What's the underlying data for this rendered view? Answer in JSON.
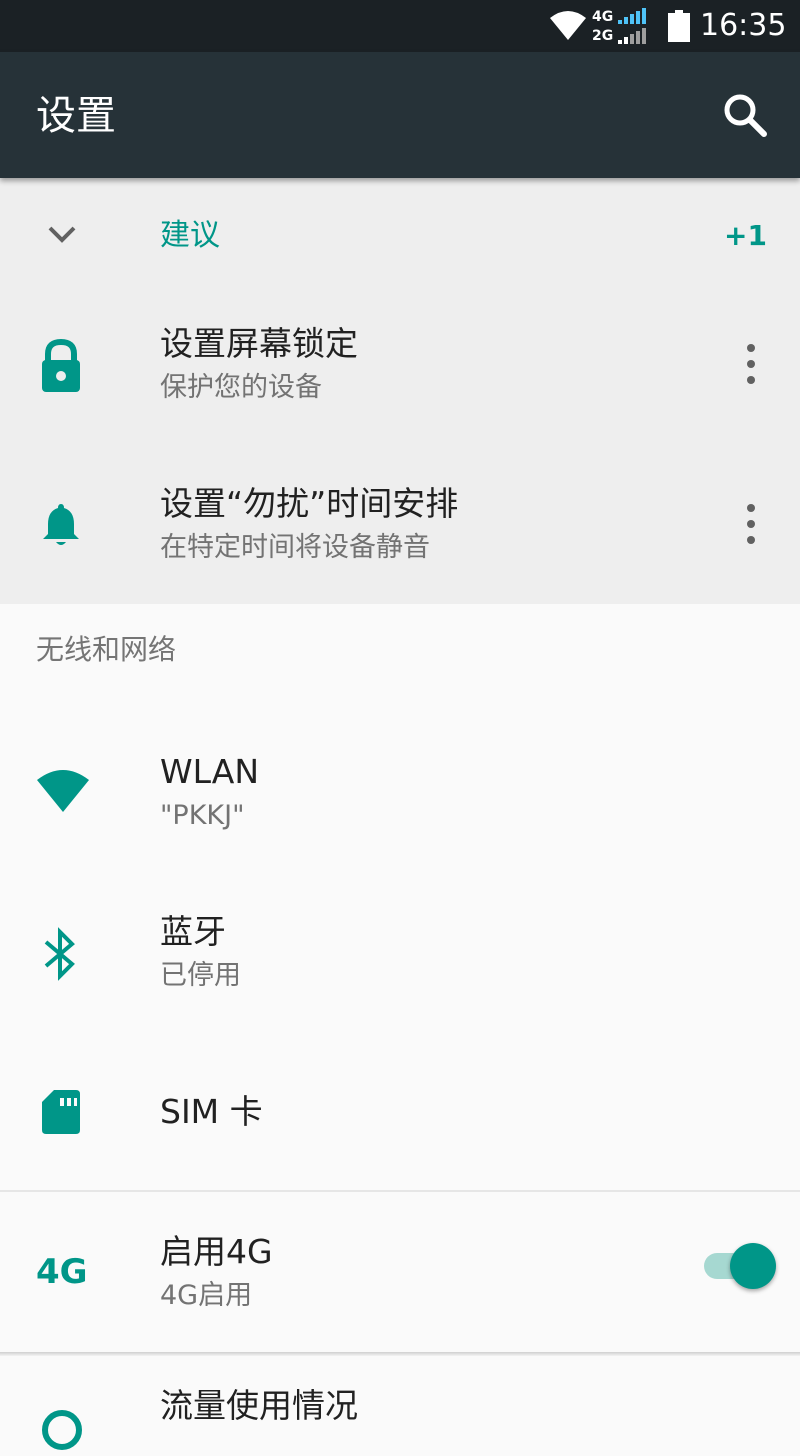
{
  "status_bar": {
    "net_top": "4G",
    "net_bottom": "2G",
    "time": "16:35"
  },
  "app_bar": {
    "title": "设置",
    "search_icon": "search-icon"
  },
  "suggestions": {
    "title": "建议",
    "count": "+1",
    "items": [
      {
        "title": "设置屏幕锁定",
        "subtitle": "保护您的设备",
        "icon": "lock-icon"
      },
      {
        "title": "设置“勿扰”时间安排",
        "subtitle": "在特定时间将设备静音",
        "icon": "bell-icon"
      }
    ]
  },
  "wireless": {
    "header": "无线和网络",
    "items": [
      {
        "title": "WLAN",
        "subtitle": "\"PKKJ\"",
        "icon": "wifi-icon"
      },
      {
        "title": "蓝牙",
        "subtitle": "已停用",
        "icon": "bluetooth-icon"
      },
      {
        "title": "SIM 卡",
        "icon": "sim-card-icon"
      },
      {
        "title": "启用4G",
        "subtitle": "4G启用",
        "icon_label": "4G",
        "toggle_on": true
      },
      {
        "title": "流量使用情况",
        "icon": "data-usage-icon"
      }
    ]
  },
  "colors": {
    "accent": "#009688",
    "app_bar": "#263238",
    "status_bar": "#1b2125"
  }
}
